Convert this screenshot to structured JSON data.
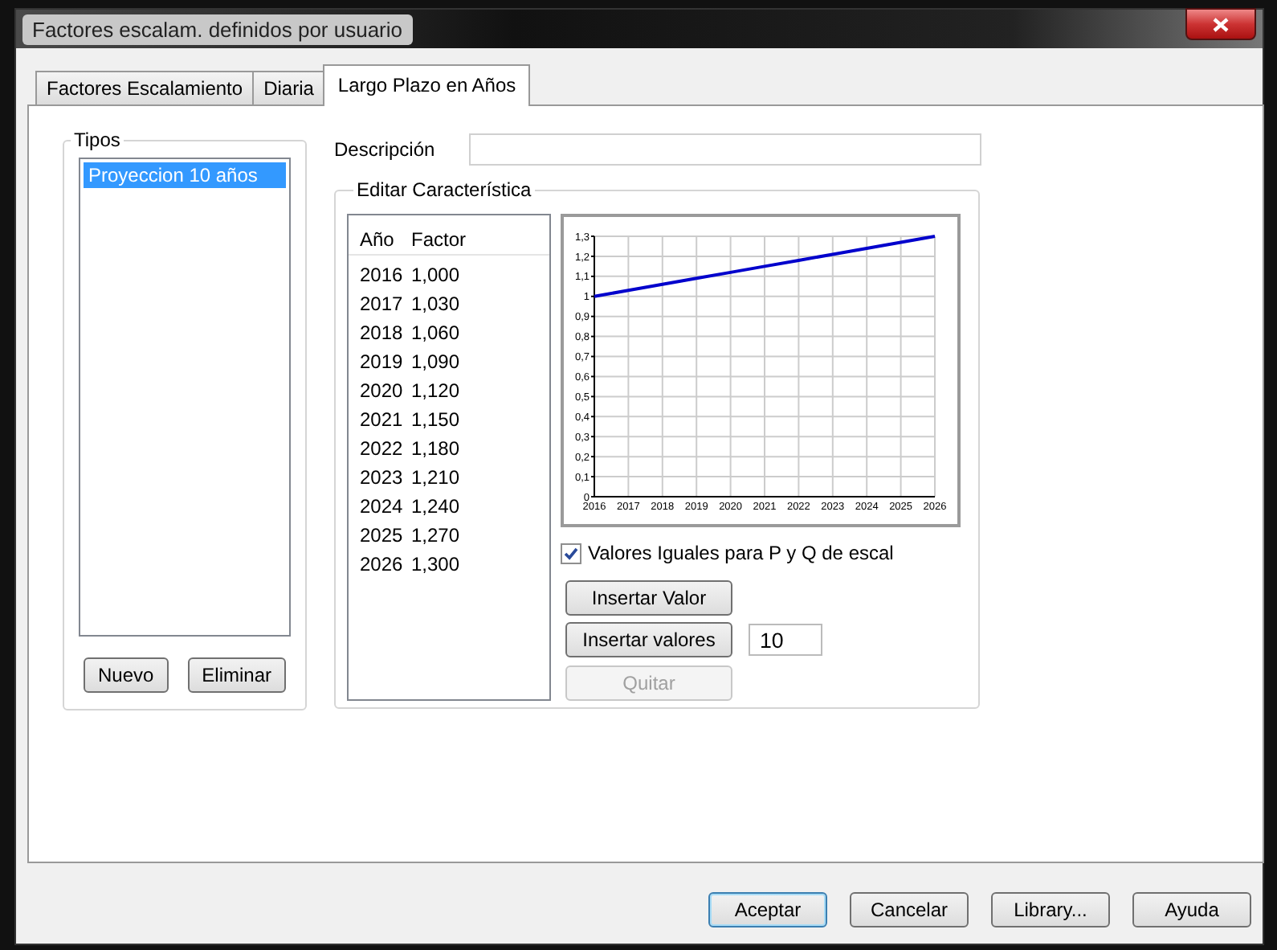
{
  "window": {
    "title": "Factores escalam. definidos por usuario"
  },
  "tabs": [
    {
      "label": "Factores Escalamiento",
      "selected": false
    },
    {
      "label": "Diaria",
      "selected": false
    },
    {
      "label": "Largo Plazo en Años",
      "selected": true
    }
  ],
  "tipos": {
    "title": "Tipos",
    "items": [
      {
        "label": "Proyeccion 10 años",
        "selected": true
      }
    ],
    "buttons": [
      "Nuevo",
      "Eliminar"
    ]
  },
  "descripcion": {
    "label": "Descripción"
  },
  "editar": {
    "title": "Editar Característica",
    "table": {
      "columns": [
        "Año",
        "Factor"
      ],
      "rows": [
        [
          "2016",
          "1,000"
        ],
        [
          "2017",
          "1,030"
        ],
        [
          "2018",
          "1,060"
        ],
        [
          "2019",
          "1,090"
        ],
        [
          "2020",
          "1,120"
        ],
        [
          "2021",
          "1,150"
        ],
        [
          "2022",
          "1,180"
        ],
        [
          "2023",
          "1,210"
        ],
        [
          "2024",
          "1,240"
        ],
        [
          "2025",
          "1,270"
        ],
        [
          "2026",
          "1,300"
        ]
      ]
    },
    "chart_data": {
      "type": "line",
      "categories": [
        "2016",
        "2017",
        "2018",
        "2019",
        "2020",
        "2021",
        "2022",
        "2023",
        "2024",
        "2025",
        "2026"
      ],
      "grid": true,
      "series": [
        {
          "color": "#0000cc",
          "values": [
            1.0,
            1.03,
            1.06,
            1.09,
            1.12,
            1.15,
            1.18,
            1.21,
            1.24,
            1.27,
            1.3
          ]
        }
      ],
      "ylim": [
        0,
        1.3
      ],
      "yticks": [
        {
          "value": 0,
          "label": "0"
        },
        {
          "value": 0.1,
          "label": "0,1"
        },
        {
          "value": 0.2,
          "label": "0,2"
        },
        {
          "value": 0.3,
          "label": "0,3"
        },
        {
          "value": 0.4,
          "label": "0,4"
        },
        {
          "value": 0.5,
          "label": "0,5"
        },
        {
          "value": 0.6,
          "label": "0,6"
        },
        {
          "value": 0.7,
          "label": "0,7"
        },
        {
          "value": 0.8,
          "label": "0,8"
        },
        {
          "value": 0.9,
          "label": "0,9"
        },
        {
          "value": 1,
          "label": "1"
        },
        {
          "value": 1.1,
          "label": "1,1"
        },
        {
          "value": 1.2,
          "label": "1,2"
        },
        {
          "value": 1.3,
          "label": "1,3"
        }
      ]
    },
    "checkbox": {
      "label": "Valores Iguales para P y Q de escal",
      "checked": true
    },
    "insert_one": {
      "label": "Insertar Valor",
      "disabled": false
    },
    "insert_many": {
      "label": "Insertar valores",
      "disabled": false,
      "count": "10"
    },
    "remove": {
      "label": "Quitar",
      "disabled": true
    }
  },
  "buttons": [
    {
      "label": "Aceptar",
      "default": true
    },
    {
      "label": "Cancelar",
      "default": false
    },
    {
      "label": "Library...",
      "default": false
    },
    {
      "label": "Ayuda",
      "default": false
    }
  ]
}
